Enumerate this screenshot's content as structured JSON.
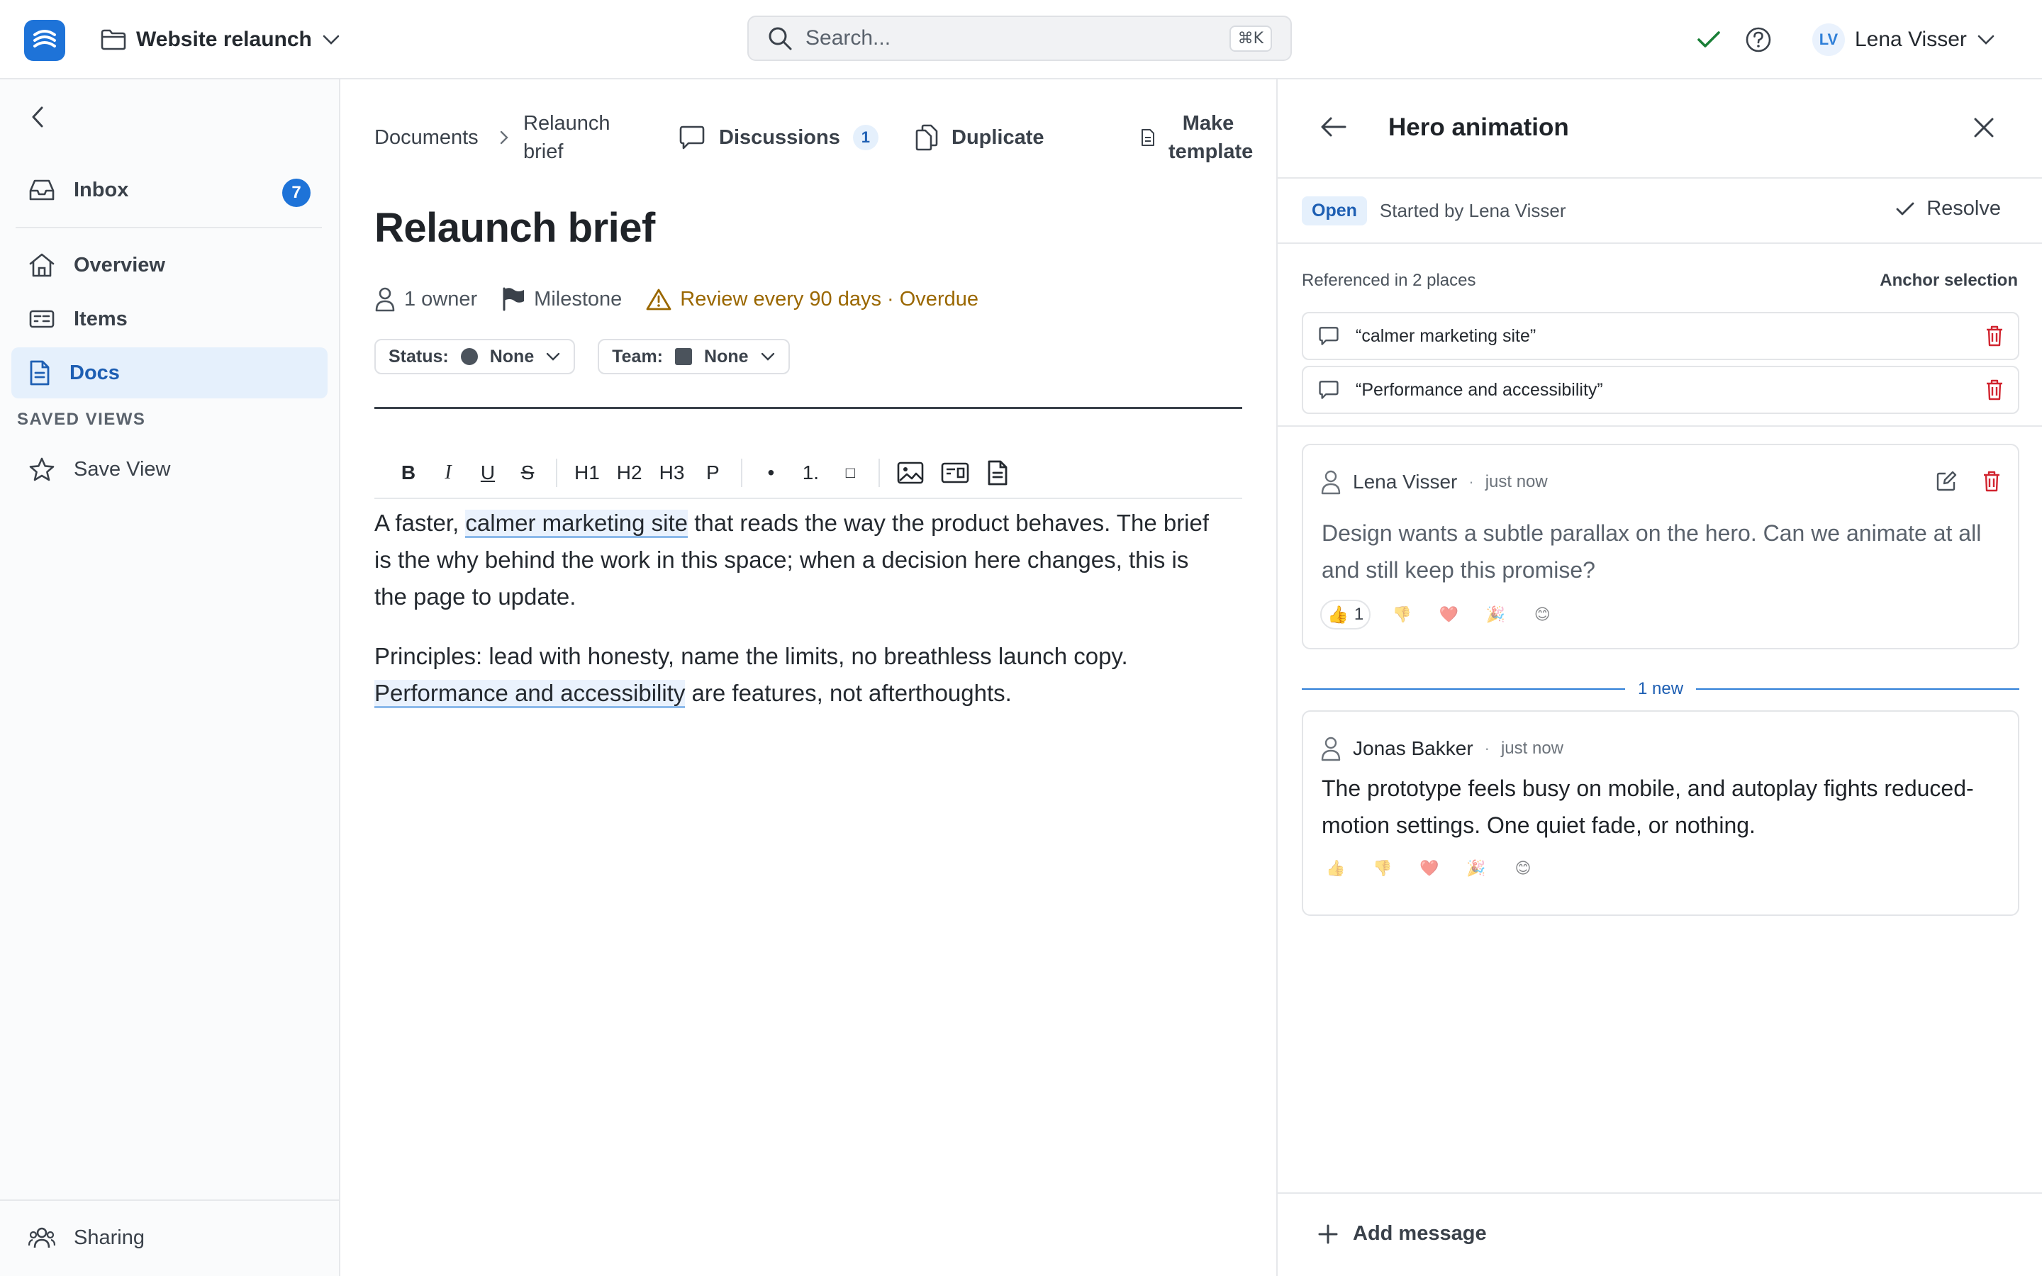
{
  "loading": {
    "progress_fraction": 0.13
  },
  "header": {
    "project_name": "Website relaunch",
    "search_placeholder": "Search...",
    "search_shortcut": "⌘K",
    "user_initials": "LV",
    "user_name": "Lena Visser",
    "icons": [
      "folder-icon",
      "chevron-down-icon",
      "search-icon",
      "check-icon",
      "help-icon"
    ]
  },
  "sidebar": {
    "items": [
      {
        "label": "Inbox",
        "icon": "inbox-icon",
        "badge": "7"
      },
      {
        "label": "Overview",
        "icon": "home-icon"
      },
      {
        "label": "Items",
        "icon": "items-icon"
      },
      {
        "label": "Docs",
        "icon": "doc-icon",
        "active": true
      }
    ],
    "saved_views_label": "SAVED VIEWS",
    "save_view_label": "Save View",
    "sharing_label": "Sharing"
  },
  "doc": {
    "breadcrumb_root": "Documents",
    "breadcrumb_current": "Relaunch brief",
    "discussions_label": "Discussions",
    "discussions_count": "1",
    "duplicate_label": "Duplicate",
    "make_template_label": "Make template",
    "title": "Relaunch brief",
    "owners": "1 owner",
    "milestone": "Milestone",
    "review": "Review every 90 days · Overdue",
    "status_key": "Status:",
    "status_value": "None",
    "team_key": "Team:",
    "team_value": "None",
    "format_buttons": [
      "B",
      "I",
      "U",
      "S",
      "H1",
      "H2",
      "H3",
      "P",
      "•",
      "1.",
      "□"
    ],
    "p1_before": "A faster, ",
    "p1_anchor": "calmer marketing site",
    "p1_after": " that reads the way the product behaves. The brief is the why behind the work in this space; when a decision here changes, this is the page to update.",
    "p2_before": "Principles: lead with honesty, name the limits, no breathless launch copy. ",
    "p2_anchor": "Performance and accessibility",
    "p2_after": " are features, not afterthoughts."
  },
  "panel": {
    "title": "Hero animation",
    "status": "Open",
    "started_by": "Started by Lena Visser",
    "resolve_label": "Resolve",
    "refs_label": "Referenced in 2 places",
    "anchor_selection_label": "Anchor selection",
    "refs": [
      "“calmer marketing site”",
      "“Performance and accessibility”"
    ],
    "messages": [
      {
        "author": "Lena Visser",
        "time": "just now",
        "text": "Design wants a subtle parallax on the hero. Can we animate at all and still keep this promise?",
        "thumbs_count": "1"
      },
      {
        "author": "Jonas Bakker",
        "time": "just now",
        "text": "The prototype feels busy on mobile, and autoplay fights reduced-motion settings. One quiet fade, or nothing."
      }
    ],
    "new_label": "1 new",
    "reactions": [
      "👍",
      "👎",
      "❤️",
      "🎉",
      "😊"
    ],
    "add_message_label": "Add message",
    "colors": {
      "accent": "#1e73d8",
      "danger": "#d1242f",
      "warning": "#9a6700",
      "success": "#1a7f37"
    }
  }
}
